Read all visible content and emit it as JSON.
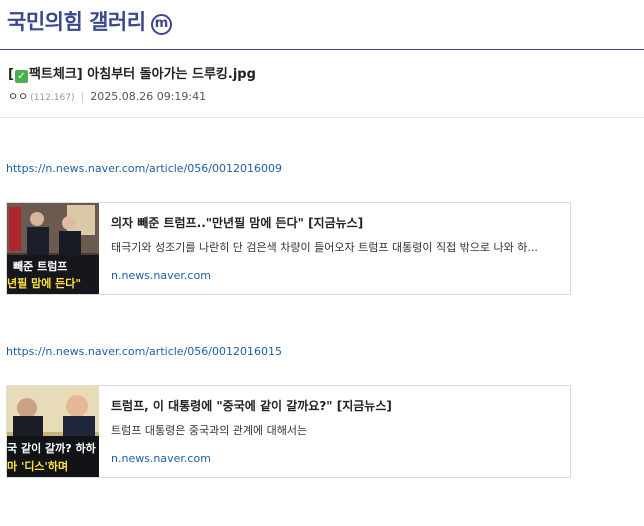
{
  "gallery": {
    "title": "국민의힘 갤러리",
    "badge": "m"
  },
  "post": {
    "head_open": "[",
    "head_close": "팩트체크]",
    "check_icon": "check-mark-icon",
    "title": "아침부터 돌아가는 드루킹.jpg",
    "nickname": "ㅇㅇ",
    "ip": "(112.167)",
    "separator": "|",
    "date": "2025.08.26 09:19:41"
  },
  "links": [
    {
      "url": "https://n.news.naver.com/article/056/0012016009",
      "card": {
        "headline": "의자 빼준 트럼프..\"만년필 맘에 든다\" [지금뉴스]",
        "description": "태극기와 성조기를 나란히 단 검은색 차량이 들어오자 트럼프 대통령이 직접 밖으로 나와 하...",
        "domain": "n.news.naver.com",
        "thumb_caption_top": "빼준 트럼프",
        "thumb_caption_bottom": "년필 맘에 든다\""
      }
    },
    {
      "url": "https://n.news.naver.com/article/056/0012016015",
      "card": {
        "headline": "트럼프, 이 대통령에 \"중국에 같이 갈까요?\" [지금뉴스]",
        "description": "트럼프 대통령은 중국과의 관계에 대해서는",
        "domain": "n.news.naver.com",
        "thumb_caption_top": "국 같이 갈까? 하하",
        "thumb_caption_bottom": "마 '디스'하며"
      }
    }
  ],
  "colors": {
    "brand": "#3b4890",
    "link": "#1f5fa8",
    "thumb_caption_white": "#ffffff",
    "thumb_caption_yellow": "#ffe23a"
  }
}
